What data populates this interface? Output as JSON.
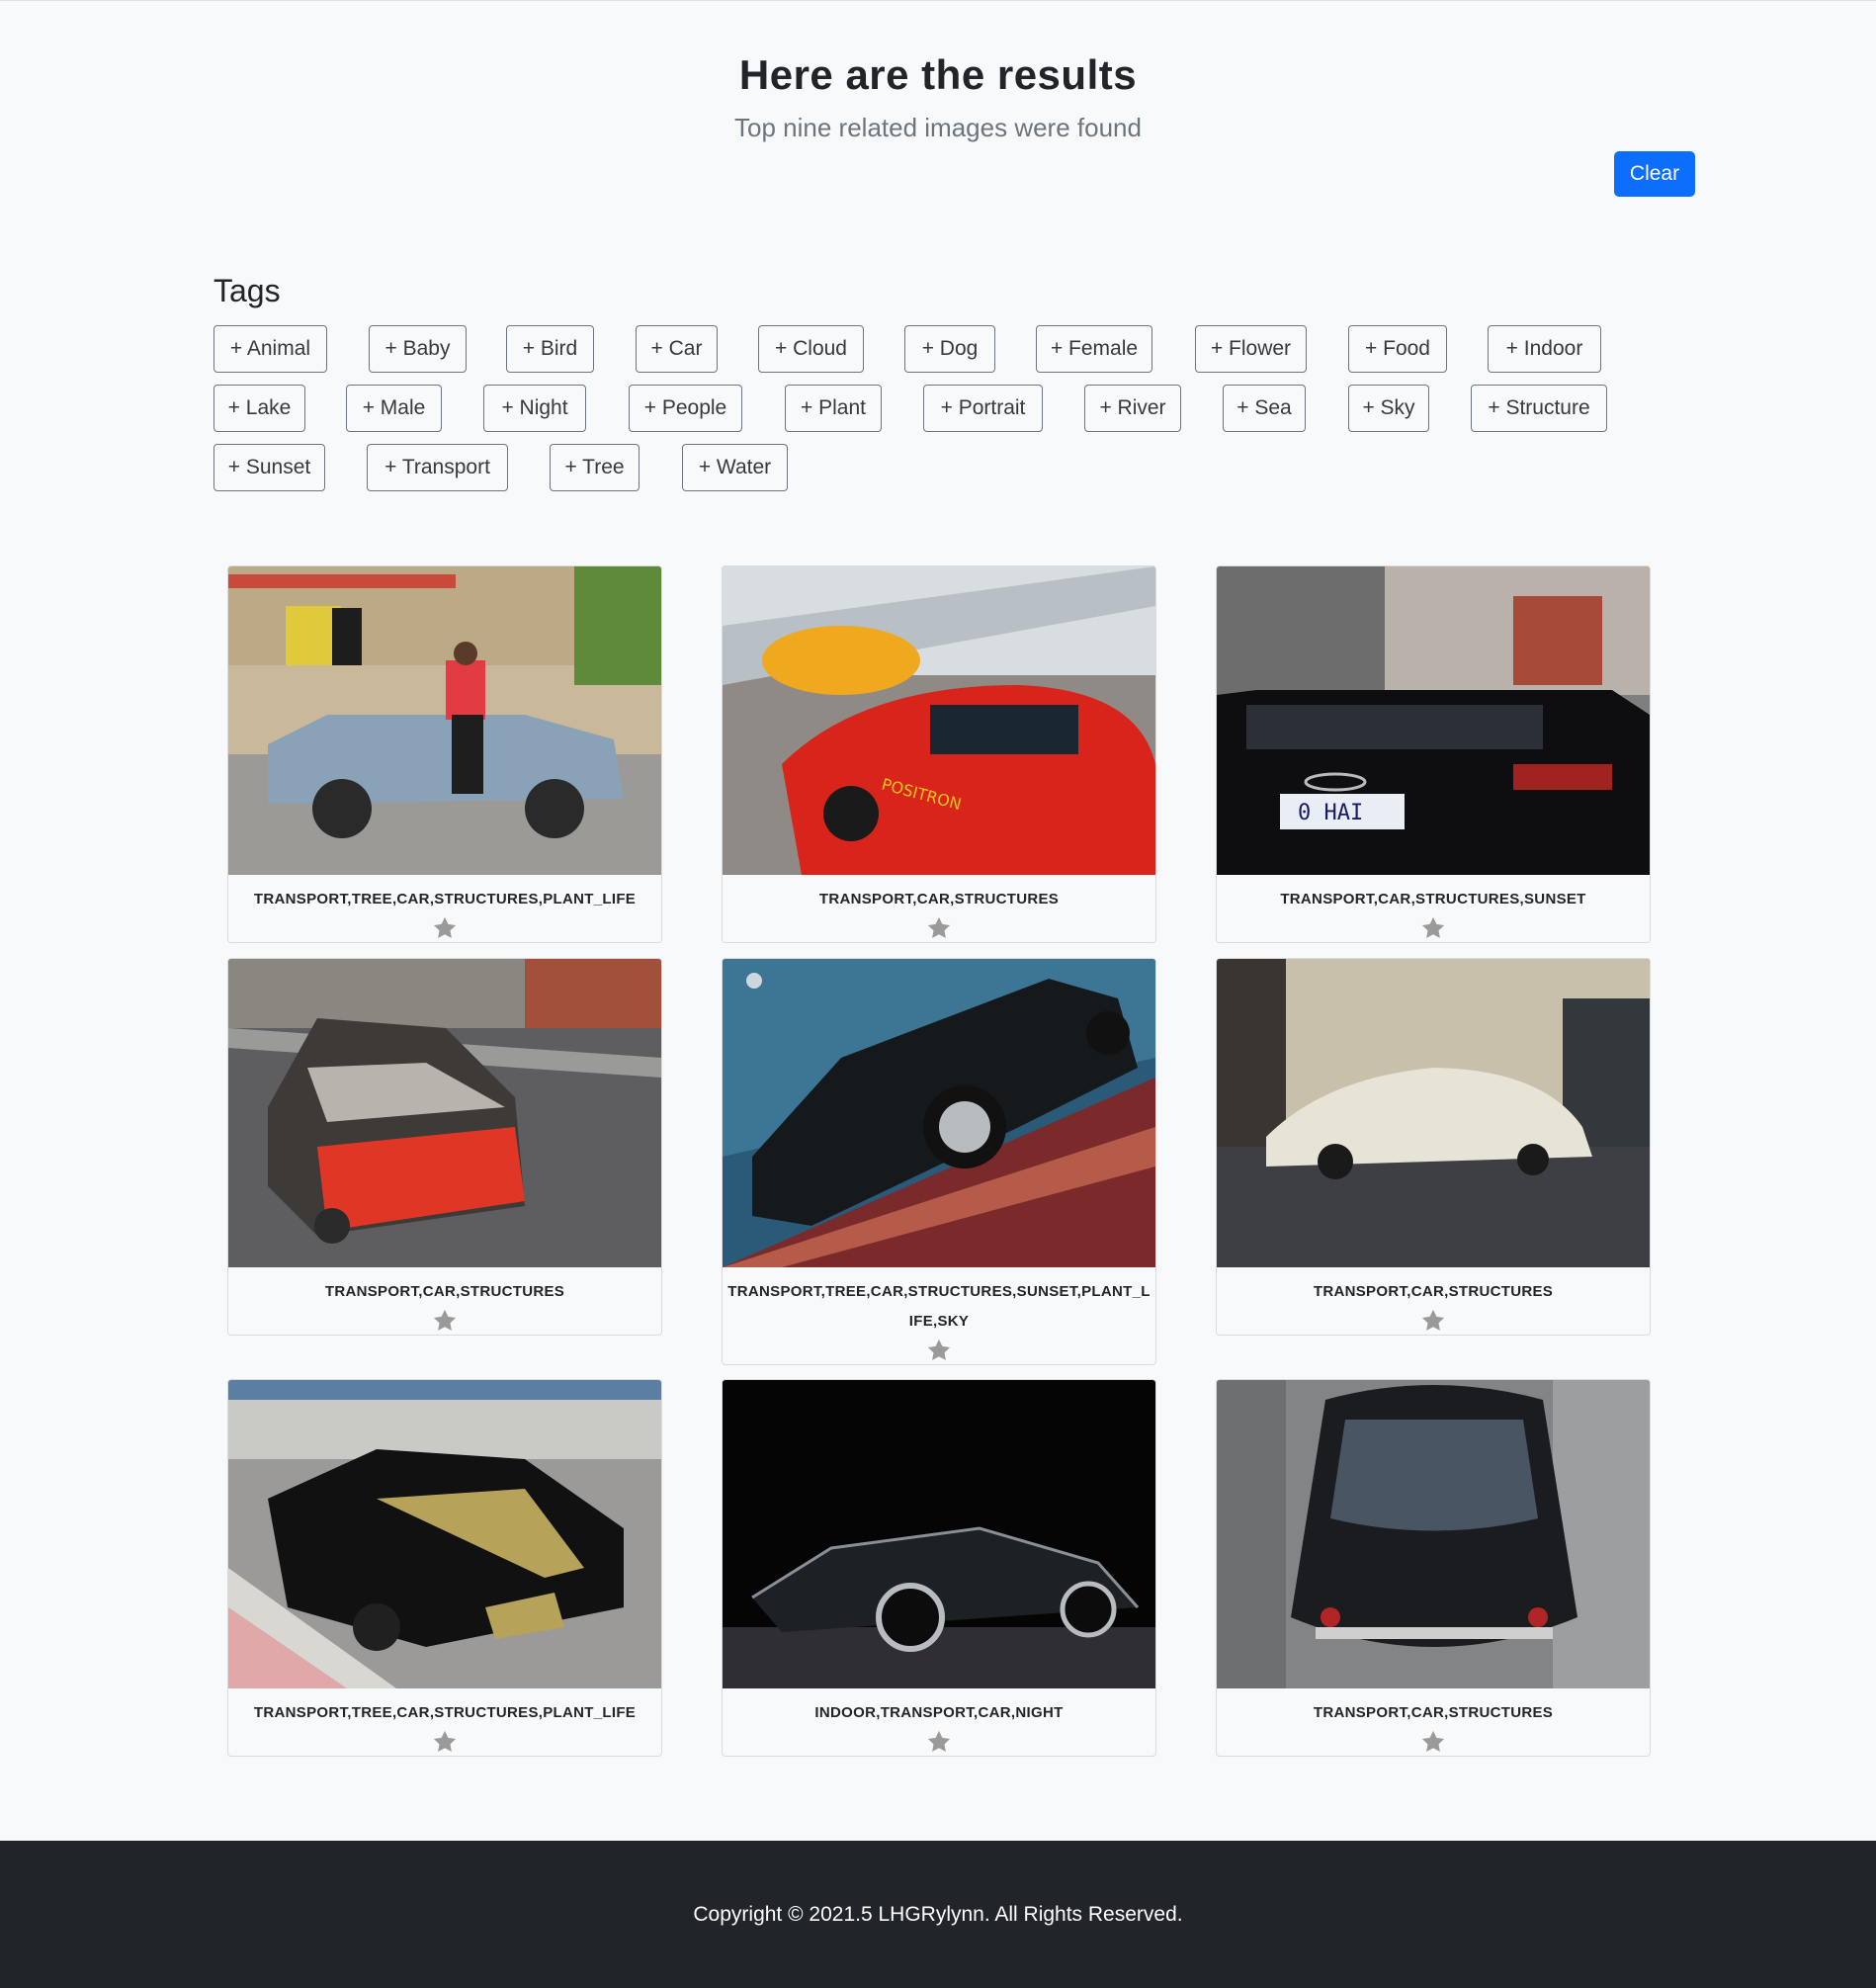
{
  "header": {
    "title": "Here are the results",
    "subtitle": "Top nine related images were found",
    "clear_label": "Clear"
  },
  "tags": {
    "heading": "Tags",
    "items": [
      "+ Animal",
      "+ Baby",
      "+ Bird",
      "+ Car",
      "+ Cloud",
      "+ Dog",
      "+ Female",
      "+ Flower",
      "+ Food",
      "+ Indoor",
      "+ Lake",
      "+ Male",
      "+ Night",
      "+ People",
      "+ Plant",
      "+ Portrait",
      "+ River",
      "+ Sea",
      "+ Sky",
      "+ Structure",
      "+ Sunset",
      "+ Transport",
      "+ Tree",
      "+ Water"
    ]
  },
  "results": [
    {
      "caption": "TRANSPORT,TREE,CAR,STRUCTURES,PLANT_LIFE",
      "photo": "light-blue sedan with man in red shirt on street"
    },
    {
      "caption": "TRANSPORT,CAR,STRUCTURES",
      "photo": "red sports car on racetrack"
    },
    {
      "caption": "TRANSPORT,CAR,STRUCTURES,SUNSET",
      "photo": "rear of black car on city street"
    },
    {
      "caption": "TRANSPORT,CAR,STRUCTURES",
      "photo": "burned-out red hatchback"
    },
    {
      "caption": "TRANSPORT,TREE,CAR,STRUCTURES,SUNSET,PLANT_LIFE,SKY",
      "photo": "black sports car in motion"
    },
    {
      "caption": "TRANSPORT,CAR,STRUCTURES",
      "photo": "white classic car on cobbled street"
    },
    {
      "caption": "TRANSPORT,TREE,CAR,STRUCTURES,PLANT_LIFE",
      "photo": "black convertible with gold stripes"
    },
    {
      "caption": "INDOOR,TRANSPORT,CAR,NIGHT",
      "photo": "black roadster in dark studio"
    },
    {
      "caption": "TRANSPORT,CAR,STRUCTURES",
      "photo": "rear of black classic car from above"
    }
  ],
  "favorite_icon": "star-icon",
  "footer": {
    "copyright": "Copyright © 2021.5 LHGRylynn. All Rights Reserved."
  },
  "colors": {
    "primary": "#0d6efd",
    "footer_bg": "#212529",
    "page_bg": "#f8f9fa",
    "star": "#9a9a9a"
  }
}
